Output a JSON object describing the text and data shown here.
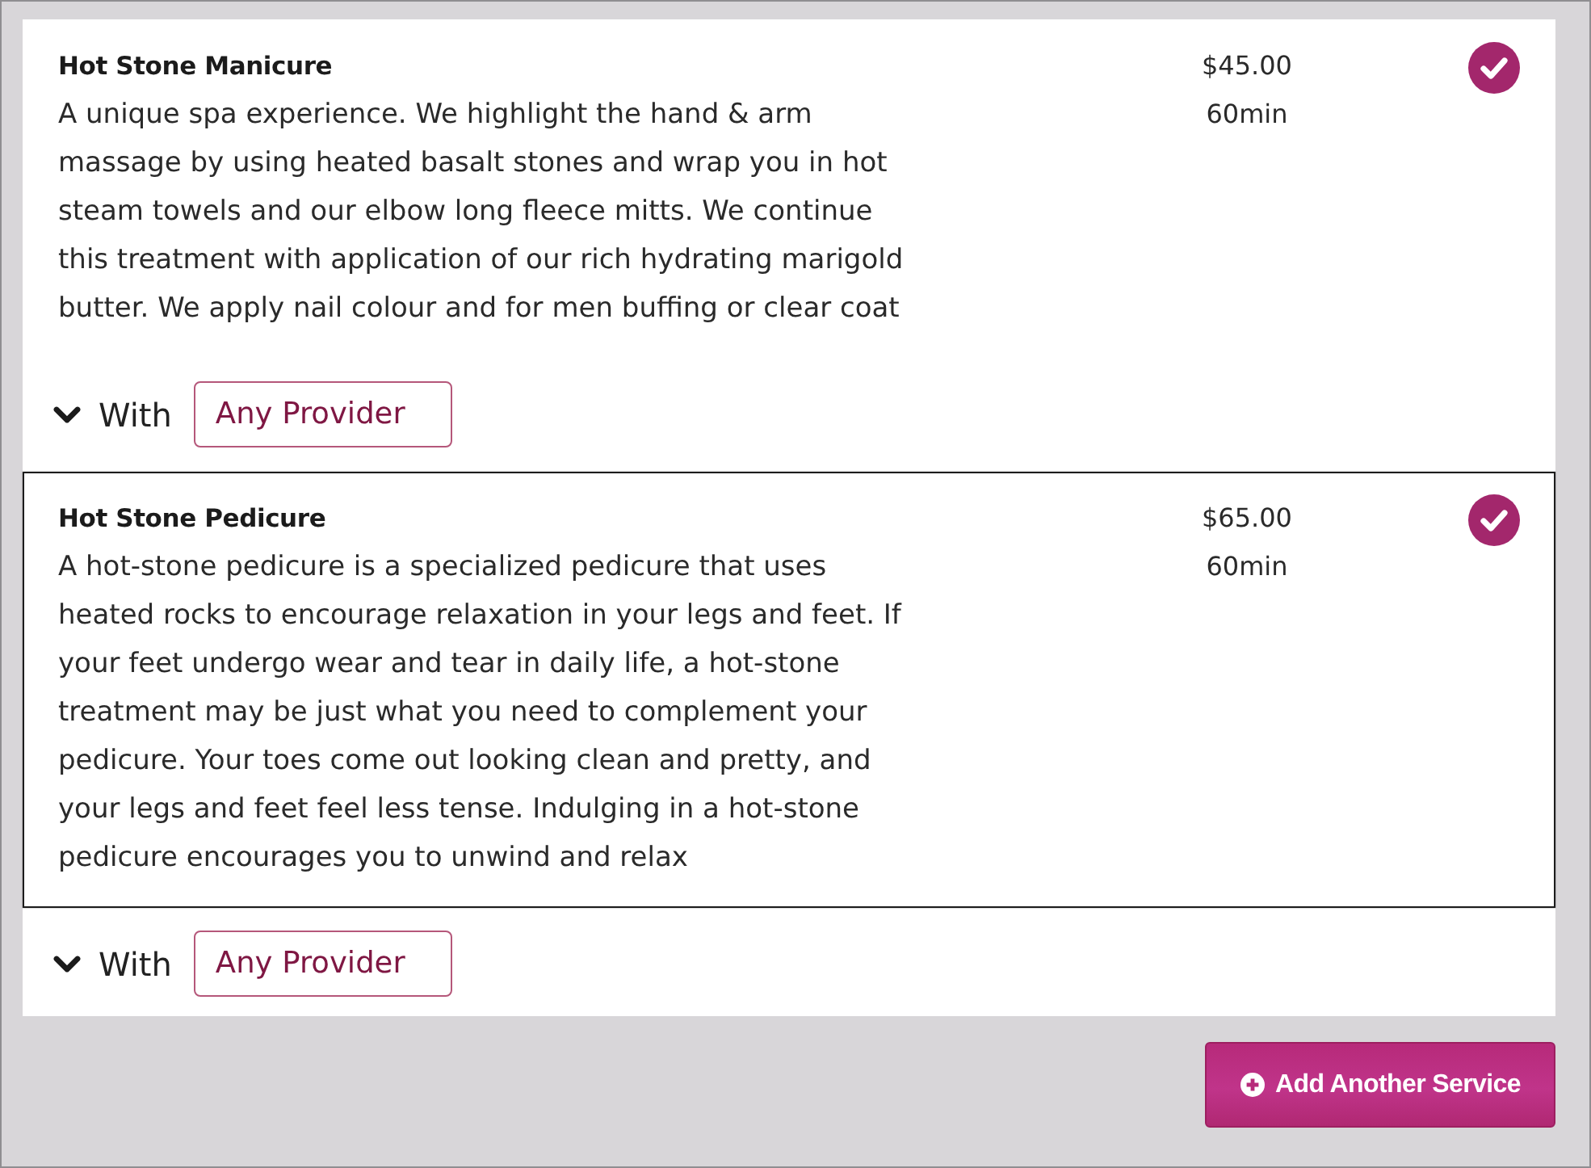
{
  "services": [
    {
      "name": "Hot Stone Manicure",
      "description": "A unique spa experience. We highlight the hand & arm massage by using heated basalt stones and wrap you in hot steam towels and our elbow long fleece mitts. We continue this treatment with application of our rich hydrating marigold butter. We apply nail colour and for men buffing or clear coat",
      "price": "$45.00",
      "duration": "60min",
      "selected": true,
      "highlighted": false,
      "provider_label": "With",
      "provider": "Any Provider"
    },
    {
      "name": "Hot Stone Pedicure",
      "description": "A hot-stone pedicure is a specialized pedicure that uses heated rocks to encourage relaxation in your legs and feet. If your feet undergo wear and tear in daily life, a hot-stone treatment may be just what you need to complement your pedicure. Your toes come out looking clean and pretty, and your legs and feet feel less tense. Indulging in a hot-stone pedicure encourages you to unwind and relax",
      "price": "$65.00",
      "duration": "60min",
      "selected": true,
      "highlighted": true,
      "provider_label": "With",
      "provider": "Any Provider"
    }
  ],
  "add_button": {
    "label": "Add Another Service"
  }
}
